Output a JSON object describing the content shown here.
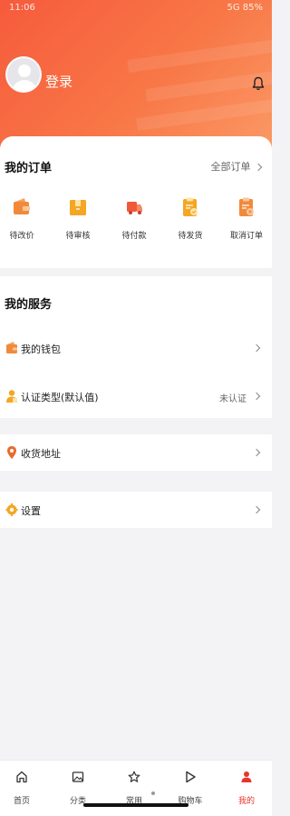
{
  "status_bar": {
    "time": "11:06",
    "icons": "5G 85%"
  },
  "header": {
    "login_label": "登录"
  },
  "orders": {
    "title": "我的订单",
    "all_label": "全部订单",
    "items": [
      {
        "label": "待改价",
        "icon": "wallet-icon"
      },
      {
        "label": "待审核",
        "icon": "box-icon"
      },
      {
        "label": "待付款",
        "icon": "truck-icon"
      },
      {
        "label": "待发货",
        "icon": "clipboard-check-icon"
      },
      {
        "label": "取消订单",
        "icon": "clipboard-cancel-icon"
      }
    ]
  },
  "services": {
    "title": "我的服务",
    "items": [
      {
        "label": "我的钱包",
        "value": ""
      },
      {
        "label": "认证类型(默认值)",
        "value": "未认证"
      }
    ]
  },
  "address": {
    "label": "收货地址"
  },
  "settings": {
    "label": "设置"
  },
  "tabbar": [
    {
      "label": "首页",
      "icon": "home-icon"
    },
    {
      "label": "分类",
      "icon": "image-icon"
    },
    {
      "label": "常用",
      "icon": "star-icon"
    },
    {
      "label": "购物车",
      "icon": "play-icon"
    },
    {
      "label": "我的",
      "icon": "person-icon"
    }
  ],
  "colors": {
    "accent": "#f65b3c",
    "icon_orange": "#f08a3a",
    "active_tab": "#e8352b"
  }
}
